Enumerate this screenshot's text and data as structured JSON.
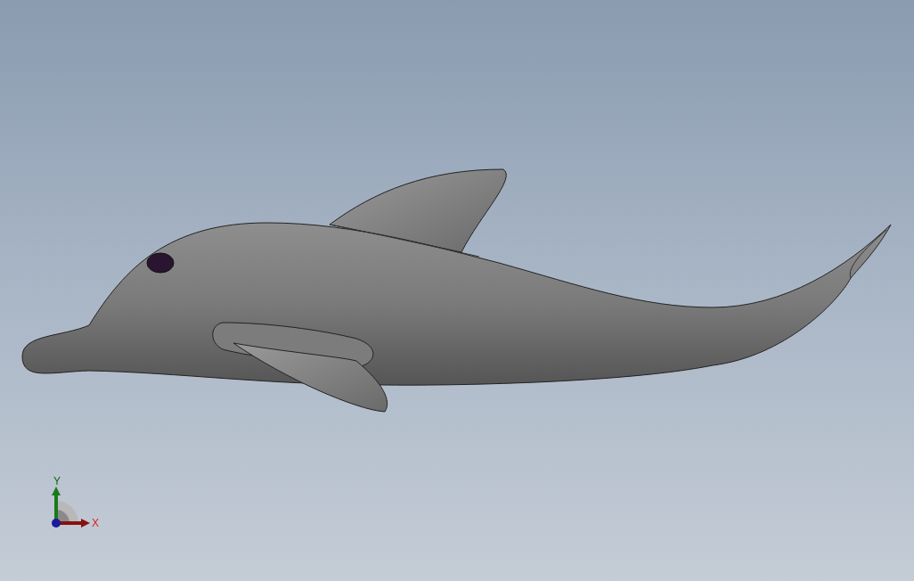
{
  "viewport": {
    "model": {
      "kind": "dolphin"
    },
    "triad": {
      "y_label": "Y",
      "x_label": "X"
    }
  }
}
